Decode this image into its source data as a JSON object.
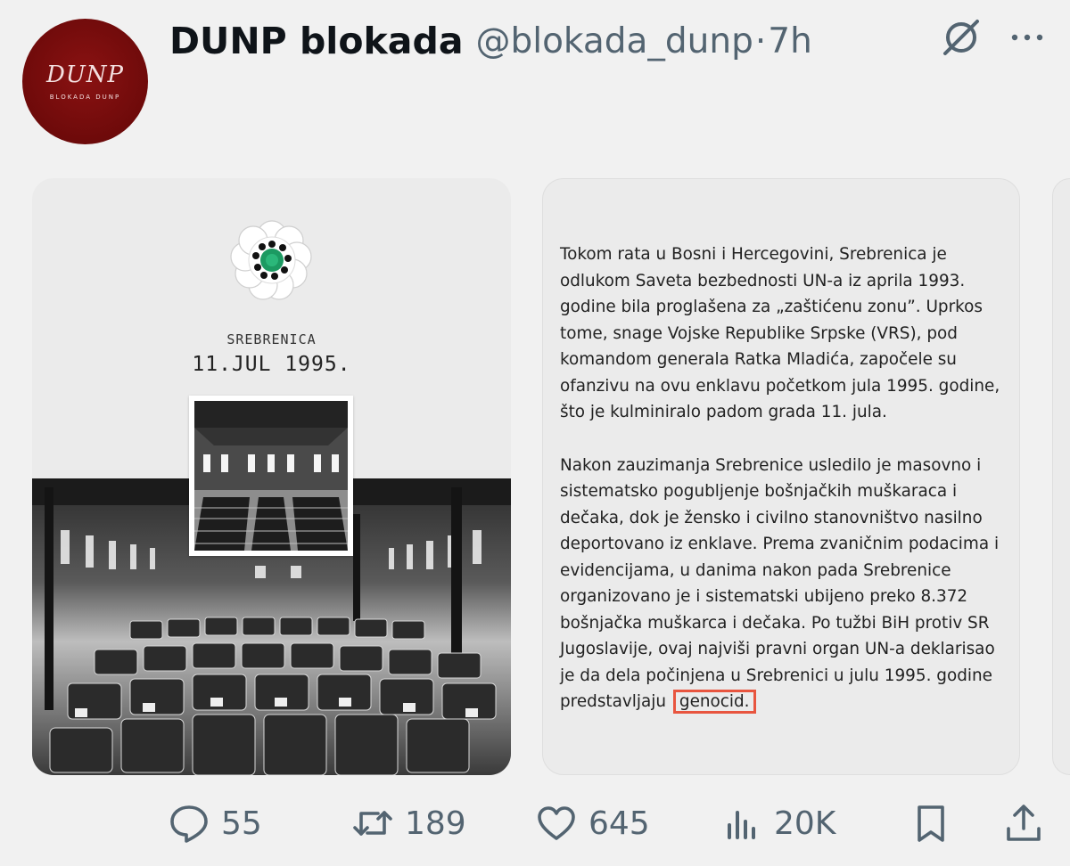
{
  "author": {
    "display_name": "DUNP blokada",
    "handle": "@blokada_dunp",
    "separator": "·",
    "time": "7h",
    "avatar_logo": "DUNP",
    "avatar_sub": "BLOKADA DUNP"
  },
  "header_icons": {
    "grok": "grok-icon",
    "more": "more-icon"
  },
  "card1": {
    "label": "SREBRENICA",
    "date": "11.JUL 1995."
  },
  "card2": {
    "paragraph1": "Tokom rata u Bosni i Hercegovini, Srebrenica je odlukom Saveta bezbednosti UN-a iz aprila 1993. godine bila proglašena za „zaštićenu zonu”. Uprkos tome, snage Vojske Republike Srpske (VRS), pod komandom generala Ratka Mladića, započele su ofanzivu na ovu enklavu početkom jula 1995. godine, što je kulminiralo padom grada 11. jula.",
    "paragraph2": "Nakon zauzimanja Srebrenice usledilo je masovno i sistematsko pogubljenje bošnjačkih muškaraca i dečaka, dok je žensko i civilno stanovništvo nasilno deportovano iz enklave. Prema zvaničnim podacima i evidencijama, u danima nakon pada Srebrenice organizovano je i sistematski ubijeno preko 8.372 bošnjačka muškarca i dečaka. Po tužbi BiH protiv SR Jugoslavije, ovaj najviši pravni organ UN-a deklarisao je da dela počinjena u Srebrenici u julu 1995. godine predstavljaju",
    "highlighted_word": "genocid.",
    "highlight_color": "#e8553f"
  },
  "actions": {
    "replies": "55",
    "retweets": "189",
    "likes": "645",
    "views": "20K"
  }
}
